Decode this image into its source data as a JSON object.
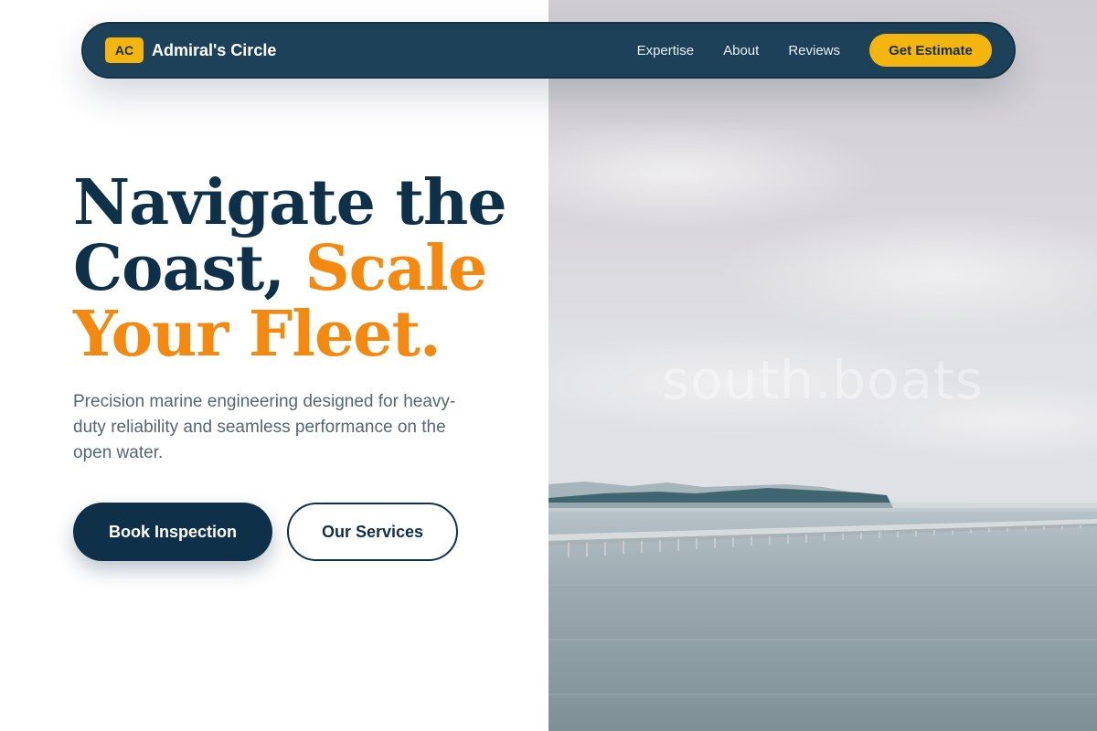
{
  "nav": {
    "brand_badge": "AC",
    "brand_name": "Admiral's Circle",
    "links": [
      "Expertise",
      "About",
      "Reviews"
    ],
    "cta_label": "Get Estimate"
  },
  "hero": {
    "title_line1": "Navigate the",
    "title_line2_plain": "Coast, ",
    "title_line2_accent": "Scale",
    "title_line3_accent": "Your Fleet.",
    "description": "Precision marine engineering designed for heavy-duty reliability and seamless performance on the open water.",
    "primary_button": "Book Inspection",
    "secondary_button": "Our Services"
  },
  "photo": {
    "watermark": "south.boats"
  },
  "colors": {
    "navy": "#0f3049",
    "nav_bg": "#1c4159",
    "accent_orange": "#f5880f",
    "accent_yellow": "#f5b50f"
  }
}
